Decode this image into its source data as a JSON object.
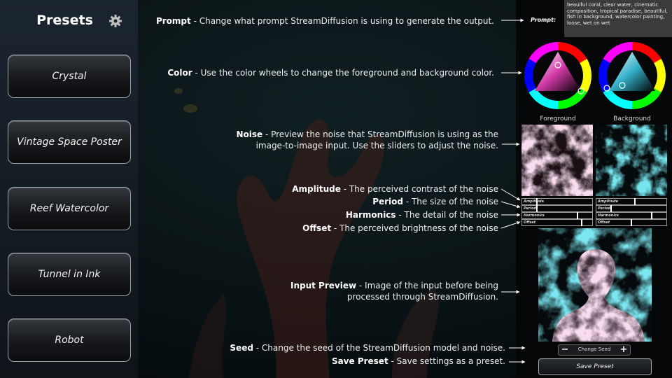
{
  "sidebar": {
    "title": "Presets",
    "presets": [
      "Crystal",
      "Vintage Space Poster",
      "Reef Watercolor",
      "Tunnel in Ink",
      "Robot"
    ]
  },
  "annotations": {
    "prompt": {
      "term": "Prompt",
      "desc": " - Change what prompt StreamDiffusion is using to generate the output."
    },
    "color": {
      "term": "Color",
      "desc": " - Use the color wheels to change the foreground and background color."
    },
    "noise": {
      "term": "Noise",
      "desc": " - Preview the noise that StreamDiffusion is using as the",
      "desc2": "image-to-image input. Use the sliders to adjust the noise."
    },
    "amplitude": {
      "term": "Amplitude",
      "desc": " - The perceived contrast of the noise"
    },
    "period": {
      "term": "Period",
      "desc": " - The size of the noise"
    },
    "harmonics": {
      "term": "Harmonics",
      "desc": " - The detail of the noise"
    },
    "offset": {
      "term": "Offset",
      "desc": " - The perceived brightness of the noise"
    },
    "input_preview": {
      "term": "Input Preview",
      "desc": " - Image of the input before being",
      "desc2": "processed through StreamDiffusion."
    },
    "seed": {
      "term": "Seed",
      "desc": " -  Change the seed of the StreamDiffusion model and noise."
    },
    "save_preset": {
      "term": "Save Preset",
      "desc": " - Save settings as a preset."
    }
  },
  "panel": {
    "prompt_label": "Prompt:",
    "prompt_text": "beauiful coral, clear water, cinematic composition, tropical paradise, beautiful, fish in background, watercolor painting, loose, wet on wet",
    "foreground_label": "Foreground",
    "background_label": "Background",
    "sliders": {
      "foreground": [
        {
          "label": "Amplitude",
          "value": 0.2
        },
        {
          "label": "Period",
          "value": 0.2
        },
        {
          "label": "Harmonics",
          "value": 0.8
        },
        {
          "label": "Offset",
          "value": 0.86
        }
      ],
      "background": [
        {
          "label": "Amplitude",
          "value": 0.55
        },
        {
          "label": "Period",
          "value": 0.2
        },
        {
          "label": "Harmonics",
          "value": 0.8
        },
        {
          "label": "Offset",
          "value": 0.5
        }
      ]
    },
    "seed_label": "Change Seed",
    "seed_minus": "−",
    "seed_plus": "+",
    "save_label": "Save Preset"
  },
  "colors": {
    "foreground": "#f2b8dc",
    "background": "#2fc6d8",
    "sidebar_bg": "#151d24"
  }
}
